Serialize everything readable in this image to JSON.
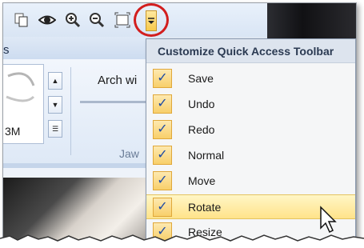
{
  "ribbon": {
    "tab_partial": "s",
    "gallery_text": "3M",
    "arch_label": "Arch wi",
    "group_label": "Jaw"
  },
  "quick_access_toolbar": {
    "icons": [
      "copy-icon",
      "eye-icon",
      "zoom-in-icon",
      "zoom-out-icon",
      "fit-to-window-icon",
      "customize-dropdown-icon"
    ]
  },
  "menu": {
    "title": "Customize Quick Access Toolbar",
    "items": [
      {
        "label": "Save",
        "checked": true
      },
      {
        "label": "Undo",
        "checked": true
      },
      {
        "label": "Redo",
        "checked": true
      },
      {
        "label": "Normal",
        "checked": true
      },
      {
        "label": "Move",
        "checked": true
      },
      {
        "label": "Rotate",
        "checked": true,
        "highlighted": true
      },
      {
        "label": "Resize",
        "checked": true
      }
    ],
    "check_glyph": "✓"
  },
  "colors": {
    "highlight_ring": "#d21e1e",
    "check_mark": "#1d4aa5",
    "hover_row": "#ffe38a"
  }
}
